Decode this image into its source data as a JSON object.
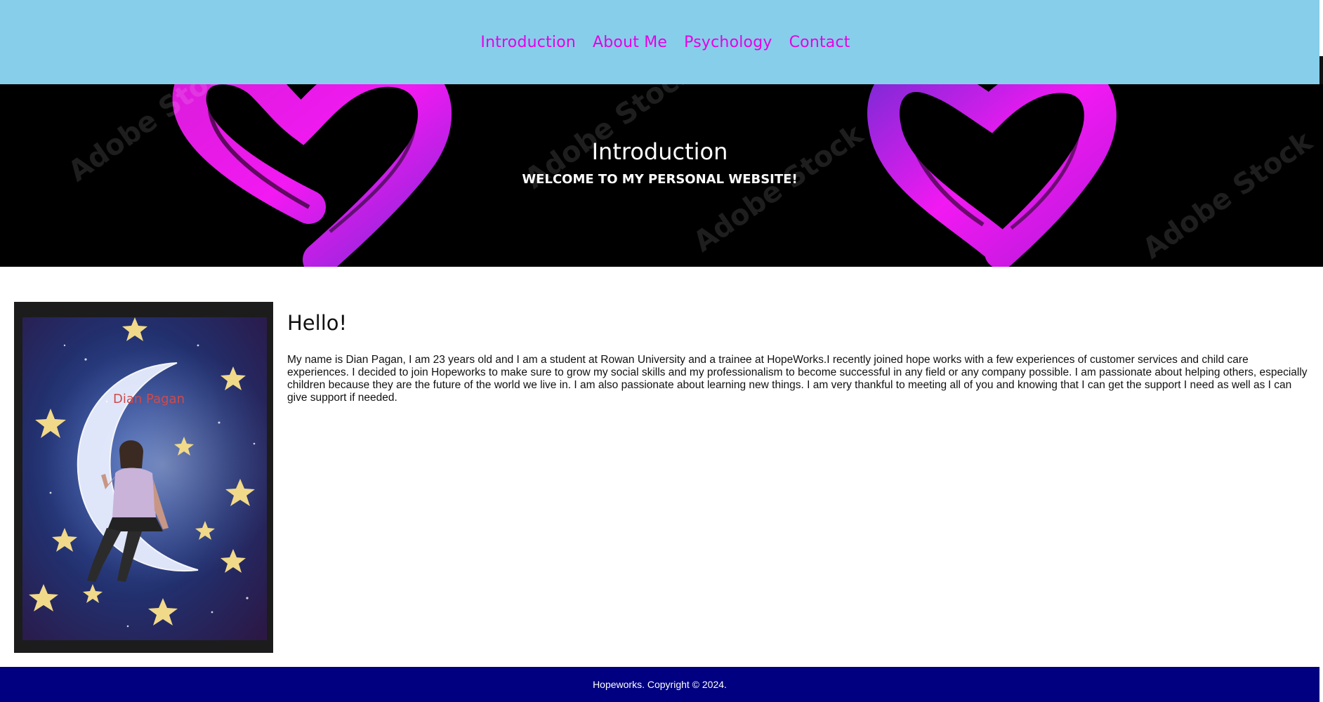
{
  "nav": {
    "items": [
      {
        "label": "Introduction"
      },
      {
        "label": "About Me"
      },
      {
        "label": "Psychology"
      },
      {
        "label": "Contact"
      }
    ]
  },
  "hero": {
    "title": "Introduction",
    "subtitle": "WELCOME TO MY PERSONAL WEBSITE!",
    "watermark": "Adobe Stock"
  },
  "profile": {
    "photo_caption": "Dian Pagan"
  },
  "main": {
    "heading": "Hello!",
    "bio": "My name is Dian Pagan, I am 23 years old and I am a student at Rowan University and a trainee at HopeWorks.I recently joined hope works with a few experiences of customer services and child care experiences. I decided to join Hopeworks to make sure to grow my social skills and my professionalism to become successful in any field or any company possible. I am passionate about helping others, especially children because they are the future of the world we live in. I am also passionate about learning new things. I am very thankful to meeting all of you and knowing that I can get the support I need as well as I can give support if needed."
  },
  "footer": {
    "text": "Hopeworks. Copyright © 2024."
  },
  "colors": {
    "nav_bg": "#87ceeb",
    "nav_link": "#e600e6",
    "hero_bg": "#000000",
    "footer_bg": "#000080"
  }
}
